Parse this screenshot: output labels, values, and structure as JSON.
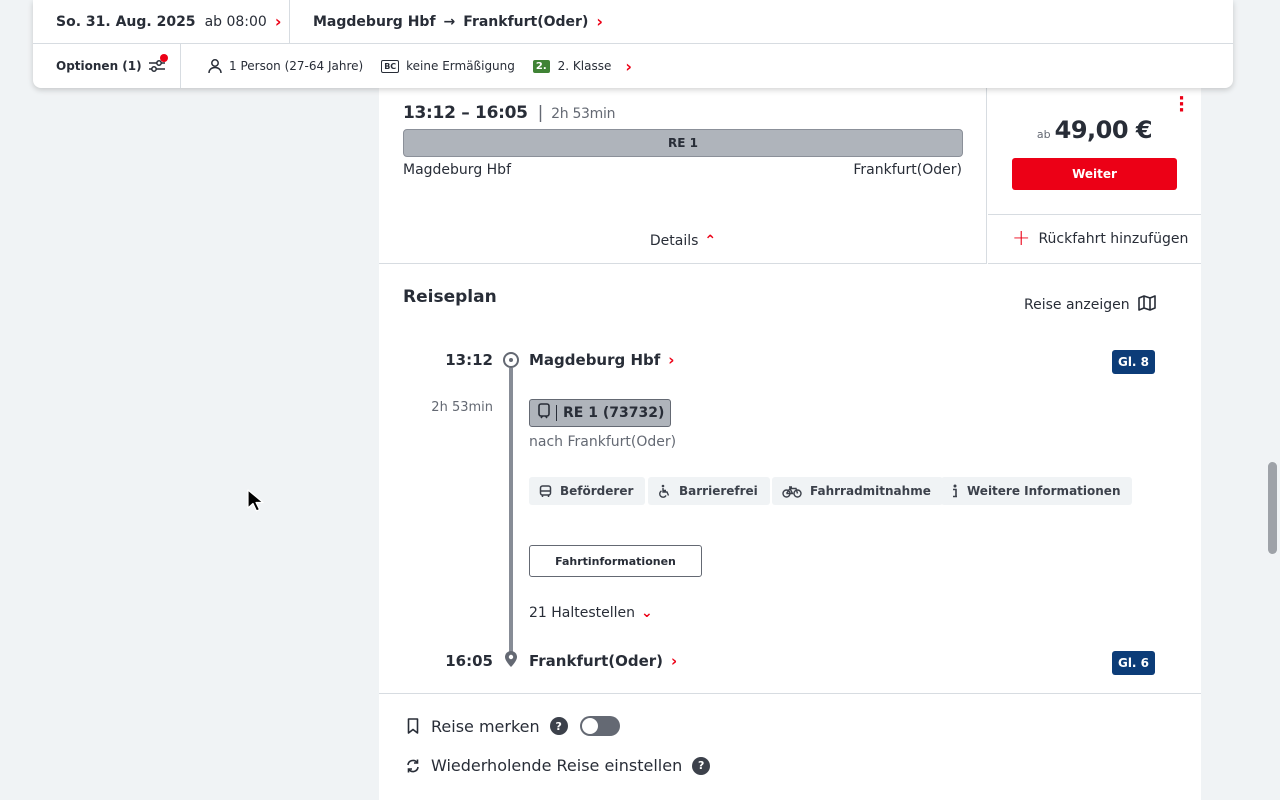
{
  "header": {
    "date": "So. 31. Aug. 2025",
    "time": "ab 08:00",
    "from": "Magdeburg Hbf",
    "to": "Frankfurt(Oder)",
    "options_label": "Optionen (1)",
    "traveller": "1 Person (27-64 Jahre)",
    "discount_badge": "BC",
    "discount": "keine Ermäßigung",
    "class_badge": "2.",
    "class_label": "2. Klasse"
  },
  "connection": {
    "times": "13:12 – 16:05",
    "duration": "2h 53min",
    "train": "RE 1",
    "from": "Magdeburg Hbf",
    "to": "Frankfurt(Oder)",
    "details_label": "Details",
    "price_prefix": "ab",
    "price": "49,00 €",
    "weiter_label": "Weiter",
    "return_label": "Rückfahrt hinzufügen"
  },
  "reiseplan": {
    "title": "Reiseplan",
    "show_trip": "Reise anzeigen",
    "dep_time": "13:12",
    "dep_station": "Magdeburg Hbf",
    "dep_platform": "Gl. 8",
    "duration": "2h 53min",
    "train": "RE 1 (73732)",
    "direction": "nach Frankfurt(Oder)",
    "chips": [
      "Beförderer",
      "Barrierefrei",
      "Fahrradmitnahme",
      "Weitere Informationen"
    ],
    "info_button": "Fahrtinformationen",
    "stops": "21 Haltestellen",
    "arr_time": "16:05",
    "arr_station": "Frankfurt(Oder)",
    "arr_platform": "Gl. 6"
  },
  "actions": {
    "save": "Reise merken",
    "repeat": "Wiederholende Reise einstellen",
    "help": "?"
  },
  "colors": {
    "accent": "#ec0016",
    "platform": "#0c3c78",
    "class_green": "#408335"
  }
}
